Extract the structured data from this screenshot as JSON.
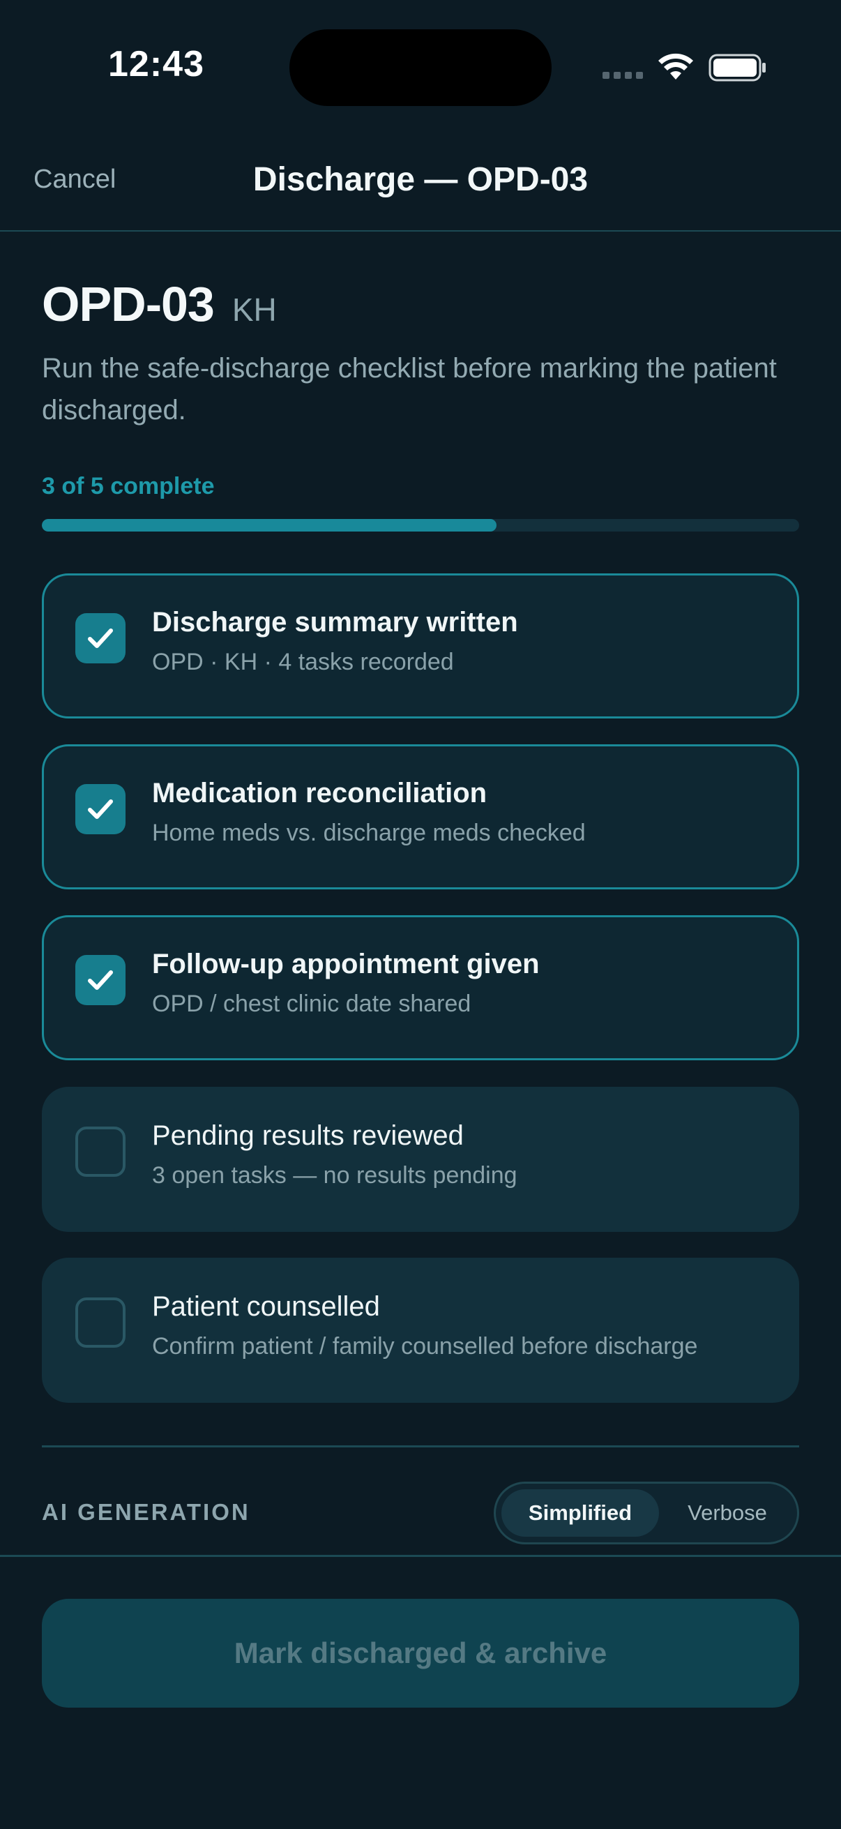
{
  "status_bar": {
    "time": "12:43"
  },
  "nav": {
    "cancel_label": "Cancel",
    "title": "Discharge — OPD-03"
  },
  "patient": {
    "id": "OPD-03",
    "initials": "KH"
  },
  "instructions": "Run the safe-discharge checklist before marking the patient discharged.",
  "progress": {
    "label": "3 of 5 complete",
    "completed": 3,
    "total": 5,
    "fraction": 0.6
  },
  "checklist": [
    {
      "title": "Discharge summary written",
      "subtitle": "OPD · KH · 4 tasks recorded",
      "checked": true
    },
    {
      "title": "Medication reconciliation",
      "subtitle": "Home meds vs. discharge meds checked",
      "checked": true
    },
    {
      "title": "Follow-up appointment given",
      "subtitle": "OPD / chest clinic date shared",
      "checked": true
    },
    {
      "title": "Pending results reviewed",
      "subtitle": "3 open tasks — no results pending",
      "checked": false
    },
    {
      "title": "Patient counselled",
      "subtitle": "Confirm patient / family counselled before discharge",
      "checked": false
    }
  ],
  "ai_generation": {
    "label": "AI GENERATION",
    "options": [
      "Simplified",
      "Verbose"
    ],
    "selected": "Simplified"
  },
  "primary_action": {
    "label": "Mark discharged & archive",
    "enabled": false
  },
  "colors": {
    "accent": "#177e8e",
    "background": "#0c1b24",
    "card_pending": "#12303c"
  },
  "icons": {
    "check": "checkmark-icon",
    "wifi": "wifi-icon",
    "battery": "battery-icon"
  }
}
